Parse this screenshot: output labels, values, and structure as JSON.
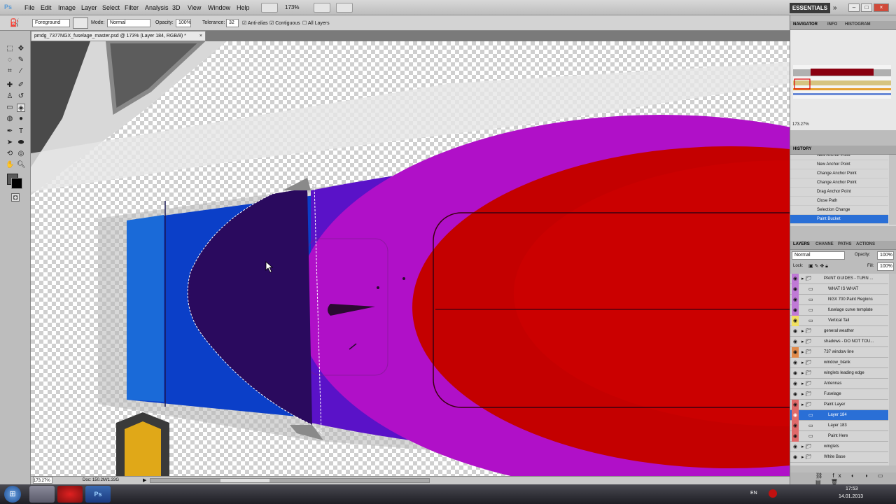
{
  "app": {
    "logo": "Ps"
  },
  "menu": [
    "File",
    "Edit",
    "Image",
    "Layer",
    "Select",
    "Filter",
    "Analysis",
    "3D",
    "View",
    "Window",
    "Help"
  ],
  "menubar_zoom": "173%",
  "workspace": "ESSENTIALS",
  "options": {
    "preset": "Foreground",
    "mode_label": "Mode:",
    "mode_value": "Normal",
    "opacity_label": "Opacity:",
    "opacity_value": "100%",
    "tolerance_label": "Tolerance:",
    "tolerance_value": "32",
    "anti_alias": "Anti-alias",
    "contiguous": "Contiguous",
    "all_layers": "All Layers"
  },
  "document": {
    "tab_title": "pmdg_7377NGX_fuselage_master.psd @ 173% (Layer 184, RGB/8) *",
    "zoom": "173.27%",
    "doc_info": "Doc: 150.2M/1.33G"
  },
  "navigator": {
    "tabs": [
      "NAVIGATOR",
      "INFO",
      "HISTOGRAM"
    ],
    "zoom": "173.27%"
  },
  "history": {
    "tab": "HISTORY",
    "items": [
      "New Anchor Point",
      "New Anchor Point",
      "Change Anchor Point",
      "Change Anchor Point",
      "Drag Anchor Point",
      "Close Path",
      "Selection Change",
      "Paint Bucket"
    ]
  },
  "layers": {
    "tabs": [
      "LAYERS",
      "CHANNE",
      "PATHS",
      "ACTIONS"
    ],
    "blend": "Normal",
    "opacity_label": "Opacity:",
    "opacity": "100%",
    "lock_label": "Lock:",
    "fill_label": "Fill:",
    "fill": "100%",
    "items": [
      {
        "name": "PAINT GUIDES - TURN ...",
        "indent": 0,
        "color": "#c07ad6"
      },
      {
        "name": "WHAT IS WHAT",
        "indent": 1,
        "color": "#c07ad6"
      },
      {
        "name": "NGX 700 Paint Regions",
        "indent": 1,
        "color": "#c07ad6"
      },
      {
        "name": "fuselage curve template",
        "indent": 1,
        "color": "#c07ad6"
      },
      {
        "name": "Vertical Tail",
        "indent": 1,
        "color": "#f0e060"
      },
      {
        "name": "general weather",
        "indent": 0,
        "color": ""
      },
      {
        "name": "shadows - DO NOT TOU...",
        "indent": 0,
        "color": ""
      },
      {
        "name": "737 window line",
        "indent": 0,
        "color": "#e08a4a"
      },
      {
        "name": "window_blank",
        "indent": 0,
        "color": ""
      },
      {
        "name": "winglets leading edge",
        "indent": 0,
        "color": ""
      },
      {
        "name": "Antennas",
        "indent": 0,
        "color": ""
      },
      {
        "name": "Fuselage",
        "indent": 0,
        "color": ""
      },
      {
        "name": "Paint Layer",
        "indent": 0,
        "color": "#e06a6a"
      },
      {
        "name": "Layer 184",
        "indent": 1,
        "color": "#e06a6a"
      },
      {
        "name": "Layer 183",
        "indent": 1,
        "color": "#e06a6a"
      },
      {
        "name": "Paint Here",
        "indent": 1,
        "color": "#e06a6a"
      },
      {
        "name": "winglets",
        "indent": 0,
        "color": ""
      },
      {
        "name": "White Base",
        "indent": 0,
        "color": ""
      }
    ],
    "selected": "Layer 184"
  },
  "taskbar": {
    "lang": "EN",
    "time": "17:53",
    "date": "14.01.2013"
  },
  "colors": {
    "fuselage_blue": "#0b3fc8",
    "selection_navy": "#2a0a5e",
    "violet": "#5a12c8",
    "magenta": "#b010c8",
    "red": "#c40000",
    "ui_select": "#2a6fd6"
  }
}
